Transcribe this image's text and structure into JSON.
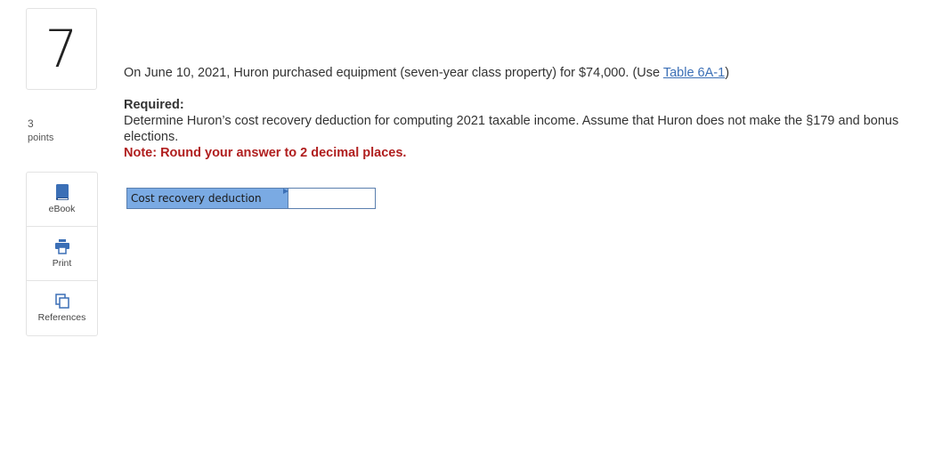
{
  "question": {
    "number": "7",
    "points_value": "3",
    "points_label": "points"
  },
  "tools": [
    {
      "label": "eBook",
      "icon": "book-icon"
    },
    {
      "label": "Print",
      "icon": "printer-icon"
    },
    {
      "label": "References",
      "icon": "references-icon"
    }
  ],
  "content": {
    "intro_text": "On June 10, 2021, Huron purchased equipment (seven-year class property) for $74,000. (Use ",
    "intro_link": "Table 6A-1",
    "intro_close": ")",
    "required_heading": "Required:",
    "prompt": "Determine Huron’s cost recovery deduction for computing 2021 taxable income. Assume that Huron does not make the §179 and bonus elections.",
    "note": "Note: Round your answer to 2 decimal places."
  },
  "answer": {
    "label": "Cost recovery deduction",
    "value": ""
  },
  "colors": {
    "link": "#3b6fb6",
    "note": "#b01e1e",
    "answer_label_bg": "#7aaae3",
    "icon_blue": "#3b6fb6"
  }
}
